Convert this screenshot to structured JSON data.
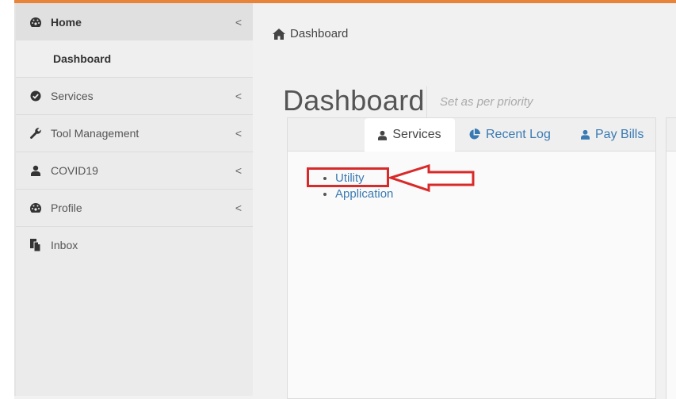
{
  "colors": {
    "accent_bar": "#e8833a",
    "link": "#3a7ab3",
    "annotation": "#d92a2a"
  },
  "sidebar": {
    "items": [
      {
        "label": "Home",
        "icon": "dashboard-gauge-icon",
        "has_chevron": true,
        "active": true
      },
      {
        "label": "Dashboard",
        "icon": null,
        "has_chevron": false,
        "submenu": true
      },
      {
        "label": "Services",
        "icon": "check-circle-icon",
        "has_chevron": true
      },
      {
        "label": "Tool Management",
        "icon": "wrench-icon",
        "has_chevron": true
      },
      {
        "label": "COVID19",
        "icon": "user-icon",
        "has_chevron": true
      },
      {
        "label": "Profile",
        "icon": "dashboard-gauge-icon",
        "has_chevron": true
      },
      {
        "label": "Inbox",
        "icon": "files-icon",
        "has_chevron": false
      }
    ],
    "chevron": "<"
  },
  "breadcrumb": {
    "icon": "home-icon",
    "label": "Dashboard"
  },
  "header": {
    "title": "Dashboard",
    "subtitle": "Set as per priority"
  },
  "tabs": [
    {
      "label": "Services",
      "icon": "user-icon",
      "active": true
    },
    {
      "label": "Recent Log",
      "icon": "pie-chart-icon",
      "active": false
    },
    {
      "label": "Pay Bills",
      "icon": "user-icon",
      "active": false
    }
  ],
  "services_list": [
    {
      "label": "Utility",
      "highlighted": true
    },
    {
      "label": "Application",
      "highlighted": false
    }
  ],
  "annotation": {
    "type": "red-arrow-pointing-left",
    "target": "Utility"
  }
}
